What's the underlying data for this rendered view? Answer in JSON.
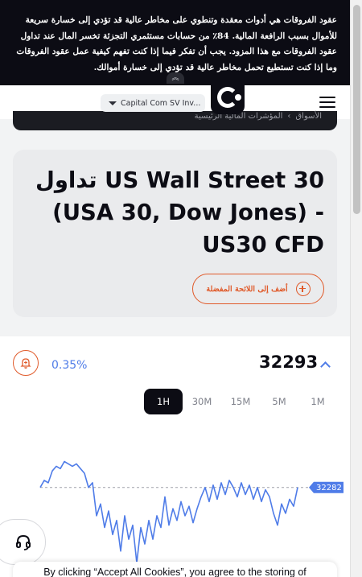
{
  "risk_banner": {
    "text": "عقود الفروقات هي أدوات معقدة وتنطوي على مخاطر عالية قد تؤدي إلى خسارة سريعة للأموال بسبب الرافعة المالية. 84٪ من حسابات مستثمري التجزئة تخسر المال عند تداول عقود الفروقات مع هذا المزود. يجب أن تفكر فيما إذا كنت تفهم كيفية عمل عقود الفروقات وما إذا كنت تستطيع تحمل مخاطر عالية قد تؤدي إلى خسارة أموالك.",
    "collapse_icon": "double-chevron-up-icon"
  },
  "header": {
    "entity_select": "Capital Com SV Inv...",
    "breadcrumb": [
      "الأسواق",
      "المؤشرات المالية الرئيسية"
    ],
    "breadcrumb_separator": "›"
  },
  "instrument": {
    "title": "تداول US Wall Street 30 (USA 30, Dow Jones) - US30 CFD",
    "favourite_label": "أضف إلى اللائحة المفضلة"
  },
  "quote": {
    "change": "0.35%",
    "price": "32293",
    "reference_price_label": "32282",
    "accent_color": "#4f7ce8",
    "brand_color": "#e05a2a"
  },
  "timeframes": {
    "items": [
      "1H",
      "30M",
      "15M",
      "5M",
      "1M"
    ],
    "selected": "1H"
  },
  "chart_data": {
    "type": "line",
    "title": "",
    "xlabel": "",
    "ylabel": "",
    "reference_line": 32282,
    "ylim": [
      32244,
      32300
    ],
    "series": [
      {
        "values": [
          32282,
          32285,
          32284,
          32289,
          32291,
          32290,
          32293,
          32292,
          32291,
          32292,
          32290,
          32288,
          32282,
          32284,
          32270,
          32275,
          32265,
          32272,
          32262,
          32268,
          32255,
          32270,
          32260,
          32266,
          32250,
          32265,
          32258,
          32268,
          32260,
          32270,
          32265,
          32278,
          32266,
          32273,
          32268,
          32276,
          32270,
          32274,
          32267,
          32273,
          32278,
          32282,
          32276,
          32283,
          32277,
          32284,
          32279,
          32285,
          32282,
          32278,
          32284,
          32279,
          32283,
          32277,
          32282,
          32276,
          32281,
          32278,
          32271,
          32266,
          32275,
          32271,
          32277,
          32274,
          32282
        ]
      }
    ]
  },
  "support": {
    "icon": "headset-icon"
  },
  "cookie": {
    "text": "By clicking “Accept All Cookies”, you agree to the storing of"
  }
}
